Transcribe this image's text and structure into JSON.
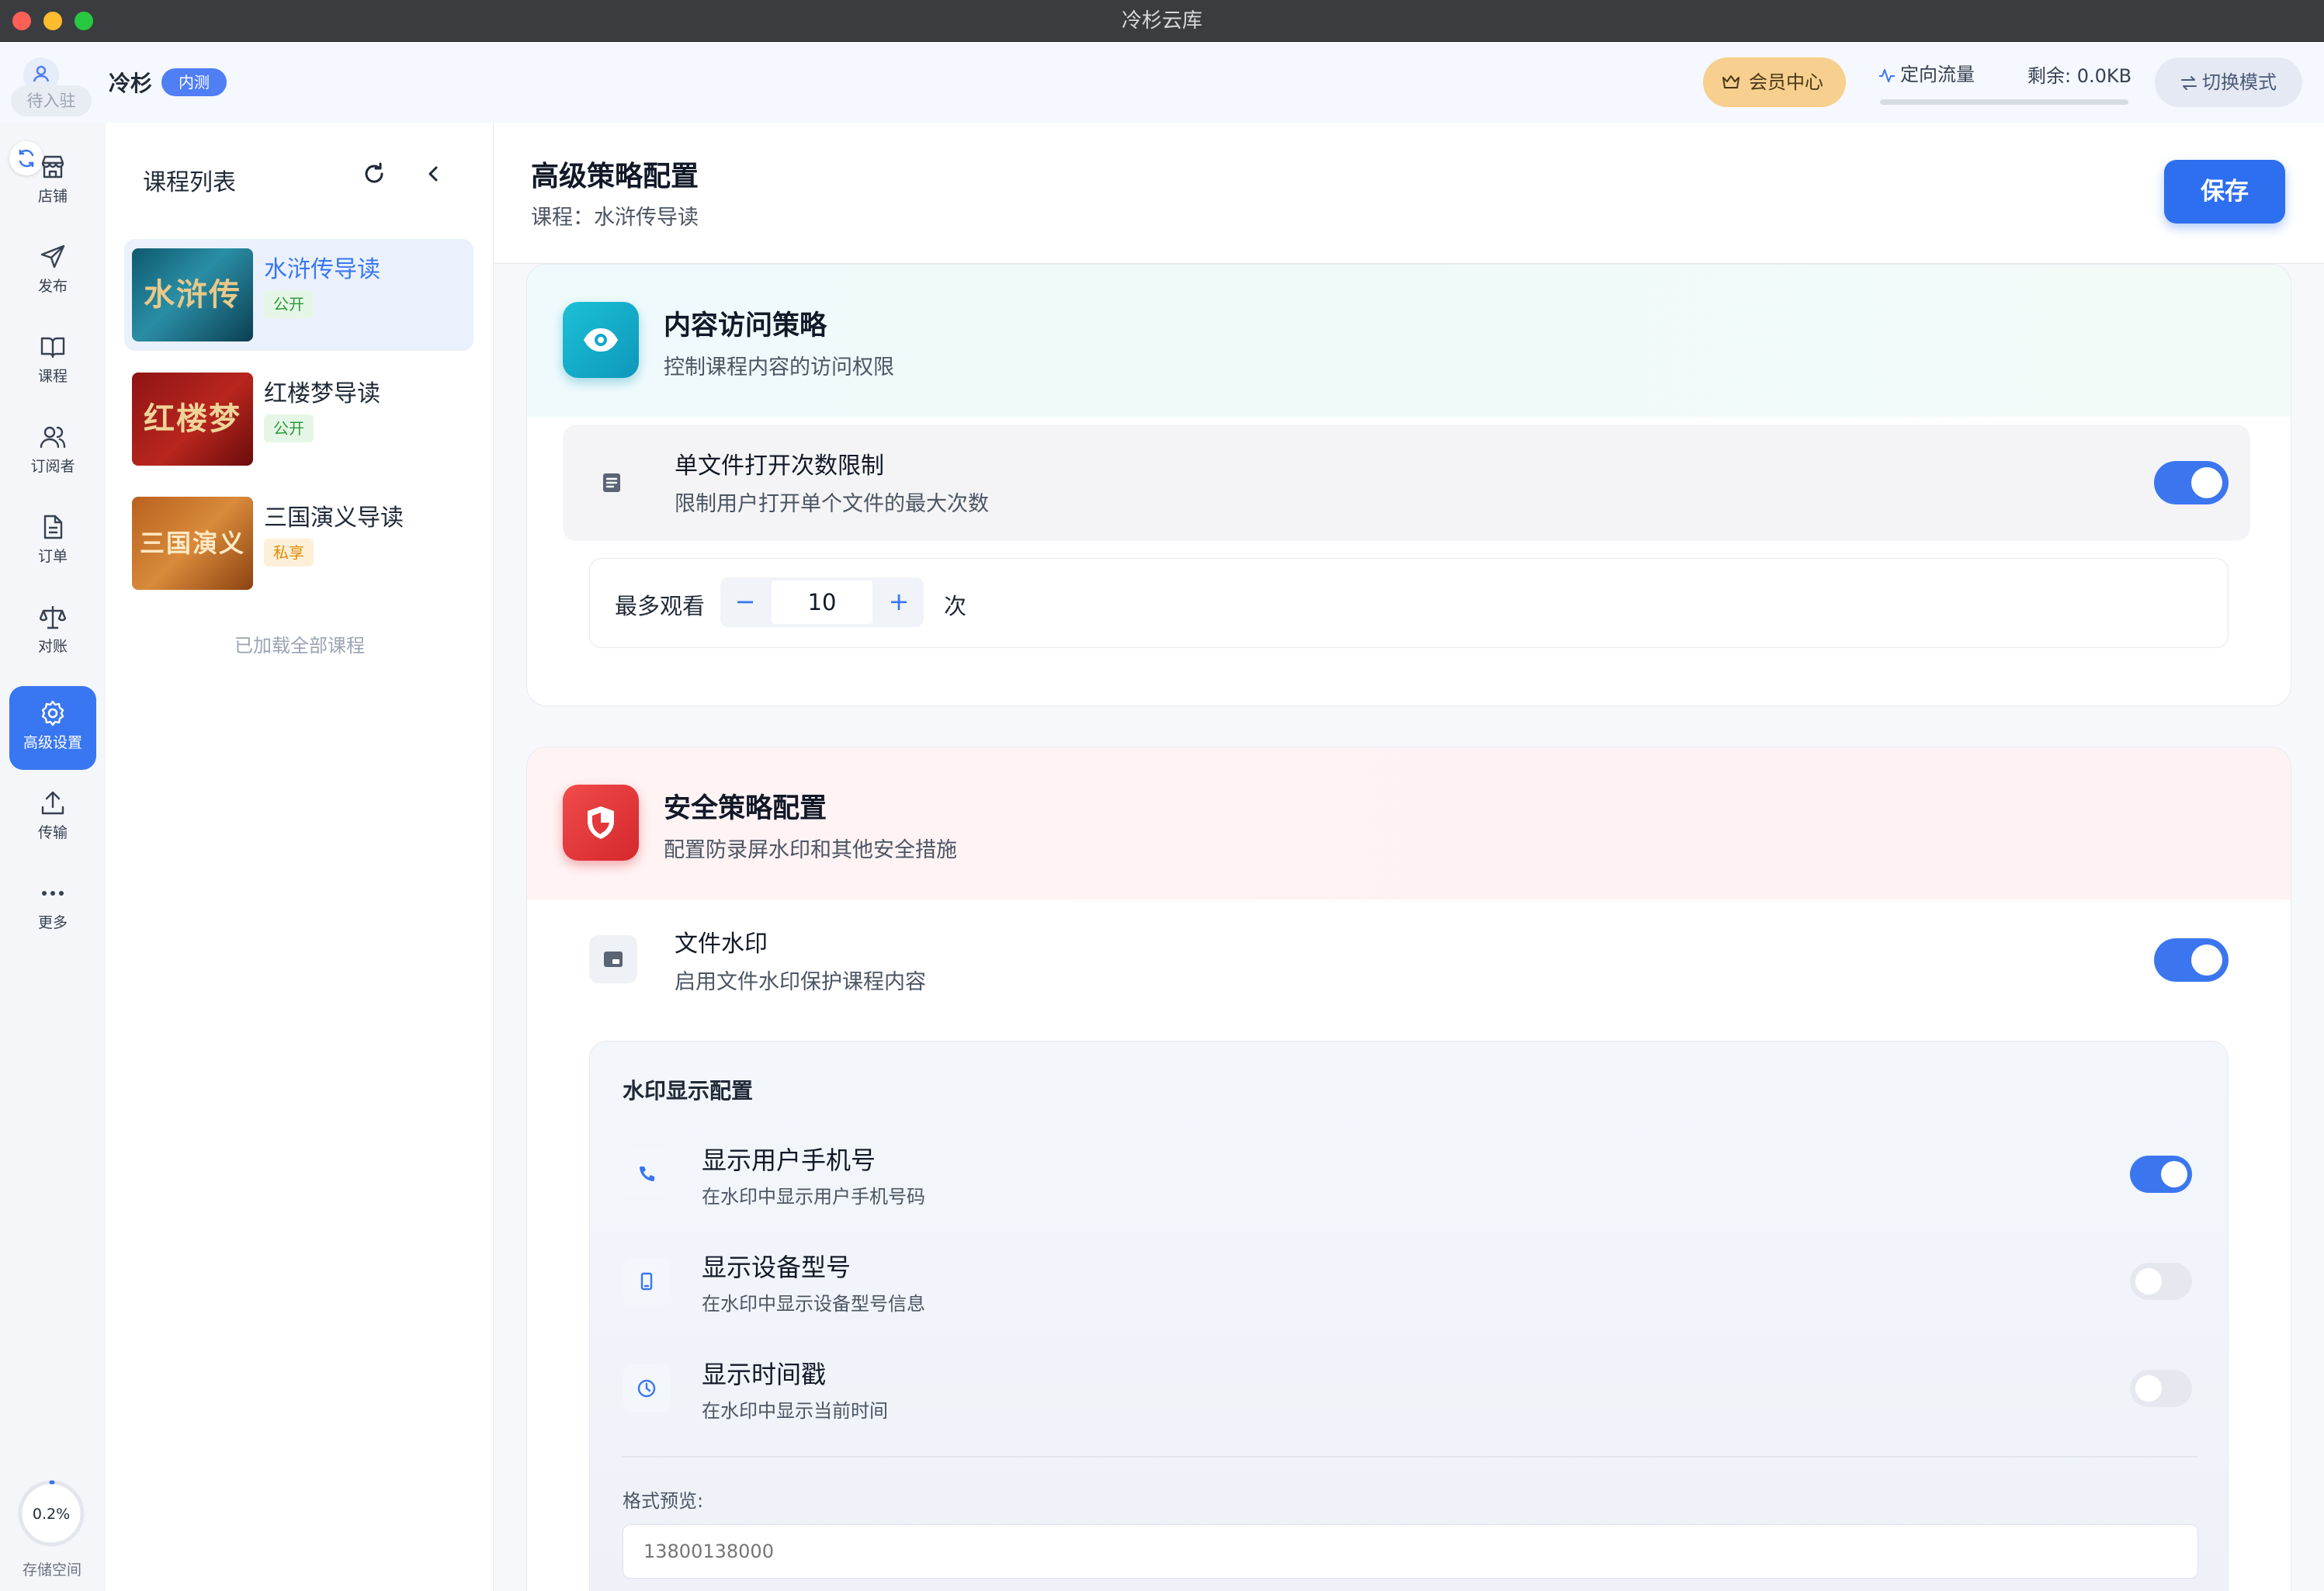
{
  "window": {
    "title": "冷杉云库"
  },
  "header": {
    "user_status": "待入驻",
    "app_name": "冷杉",
    "beta_badge": "内测",
    "vip_label": "会员中心",
    "traffic_label": "定向流量",
    "remaining": "剩余: 0.0KB",
    "switch_mode": "切换模式"
  },
  "nav": {
    "items": [
      {
        "label": "店铺",
        "icon": "store-icon"
      },
      {
        "label": "发布",
        "icon": "send-icon"
      },
      {
        "label": "课程",
        "icon": "book-icon"
      },
      {
        "label": "订阅者",
        "icon": "users-icon"
      },
      {
        "label": "订单",
        "icon": "document-icon"
      },
      {
        "label": "对账",
        "icon": "scale-icon"
      },
      {
        "label": "高级设置",
        "icon": "gear-icon",
        "active": true
      },
      {
        "label": "传输",
        "icon": "upload-icon"
      },
      {
        "label": "更多",
        "icon": "more-icon"
      }
    ],
    "storage": {
      "percent_text": "0.2%",
      "percent": 0.2,
      "label": "存储空间"
    }
  },
  "course_panel": {
    "title": "课程列表",
    "courses": [
      {
        "name": "水浒传导读",
        "status": "公开",
        "cover_text": "水浒传",
        "active": true
      },
      {
        "name": "红楼梦导读",
        "status": "公开",
        "cover_text": "红楼梦"
      },
      {
        "name": "三国演义导读",
        "status": "私享",
        "cover_text": "三国演义"
      }
    ],
    "loaded_text": "已加载全部课程"
  },
  "main": {
    "title": "高级策略配置",
    "subtitle": "课程：水浒传导读",
    "save_label": "保存",
    "access": {
      "title": "内容访问策略",
      "desc": "控制课程内容的访问权限",
      "limit": {
        "title": "单文件打开次数限制",
        "desc": "限制用户打开单个文件的最大次数",
        "enabled": true
      },
      "max_view_label": "最多观看",
      "max_view_value": "10",
      "max_view_unit": "次",
      "minus": "−",
      "plus": "+"
    },
    "security": {
      "title": "安全策略配置",
      "desc": "配置防录屏水印和其他安全措施",
      "watermark": {
        "title": "文件水印",
        "desc": "启用文件水印保护课程内容",
        "enabled": true
      },
      "display": {
        "title": "水印显示配置",
        "options": [
          {
            "title": "显示用户手机号",
            "desc": "在水印中显示用户手机号码",
            "enabled": true,
            "icon": "phone-icon"
          },
          {
            "title": "显示设备型号",
            "desc": "在水印中显示设备型号信息",
            "enabled": false,
            "icon": "device-icon"
          },
          {
            "title": "显示时间戳",
            "desc": "在水印中显示当前时间",
            "enabled": false,
            "icon": "clock-icon"
          }
        ],
        "format_label": "格式预览:",
        "format_preview": "13800138000"
      }
    }
  },
  "colors": {
    "accent": "#3976f2",
    "vip": "#f7cf8e",
    "access_icon": "#12a8c9",
    "security_icon": "#e5383b"
  }
}
